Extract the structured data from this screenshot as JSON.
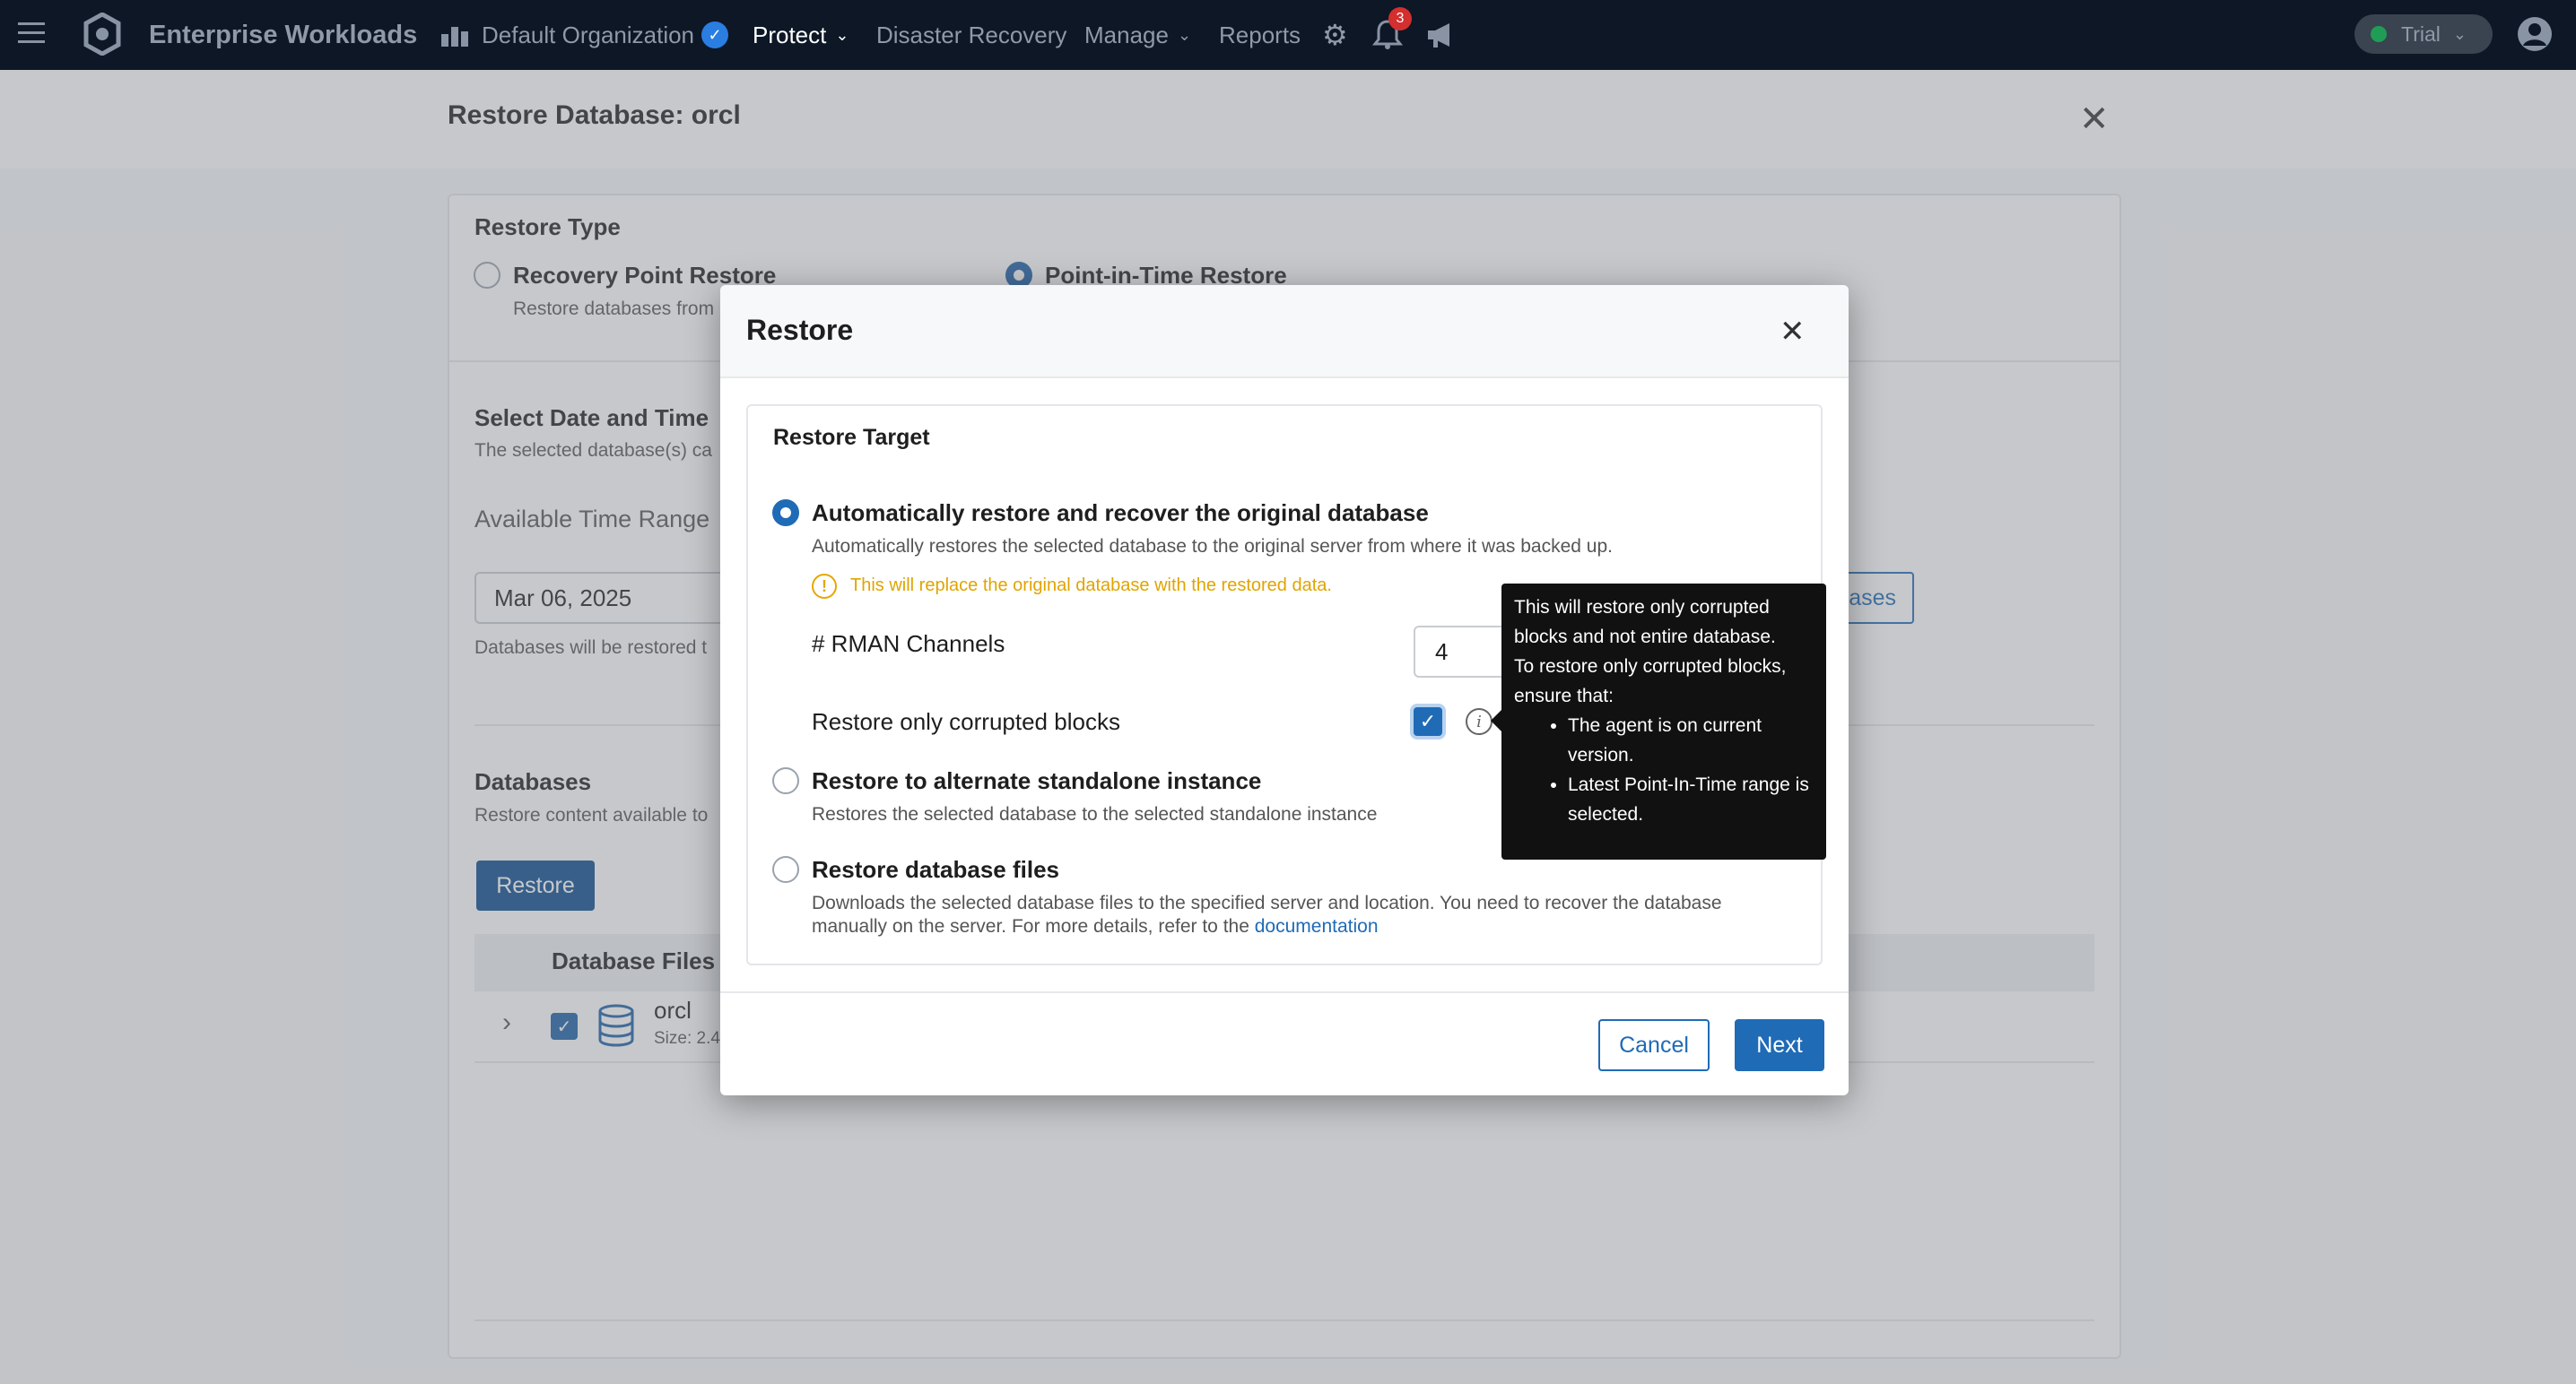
{
  "topnav": {
    "app_title": "Enterprise Workloads",
    "organization": "Default Organization",
    "items": [
      "Protect",
      "Disaster Recovery",
      "Manage",
      "Reports"
    ],
    "notification_count": "3",
    "trial_label": "Trial"
  },
  "page": {
    "title": "Restore Database: orcl",
    "restore_type_heading": "Restore Type",
    "option_recovery_point": "Recovery Point Restore",
    "option_recovery_point_desc": "Restore databases from",
    "option_pit": "Point-in-Time Restore",
    "select_date_heading": "Select Date and Time",
    "select_date_sub": "The selected database(s) ca",
    "available_time_range": "Available Time Range",
    "date_value": "Mar 06, 2025",
    "restored_note": "Databases will be restored t",
    "right_button_partial": "ases",
    "databases_heading": "Databases",
    "databases_sub": "Restore content available to",
    "restore_button": "Restore",
    "table_header": "Database Files",
    "row_name": "orcl",
    "row_size": "Size: 2.4"
  },
  "modal": {
    "title": "Restore",
    "section_title": "Restore Target",
    "option_auto_label": "Automatically restore and recover the original database",
    "option_auto_desc": "Automatically restores the selected database to the original server from where it was backed up.",
    "warning_text": "This will replace the original database with the restored data.",
    "rman_label": "# RMAN Channels",
    "rman_value": "4",
    "corrupted_label": "Restore only corrupted blocks",
    "corrupted_checked": true,
    "option_alt_label": "Restore to alternate standalone instance",
    "option_alt_desc": "Restores the selected database to the selected standalone instance",
    "option_files_label": "Restore database files",
    "option_files_desc_line1": "Downloads the selected database files to the specified server and location. You need to recover the database",
    "option_files_desc_line2": "manually on the server. For more details, refer to the",
    "option_files_link": "documentation",
    "cancel_label": "Cancel",
    "next_label": "Next"
  },
  "tooltip": {
    "lines": [
      "This will restore only corrupted",
      "blocks and not entire database.",
      "To restore only corrupted blocks,",
      "ensure that:"
    ],
    "bullets": [
      "The agent is on current version.",
      "Latest Point-In-Time range is selected."
    ]
  },
  "colors": {
    "nav_bg": "#0d1726",
    "accent": "#1f6bb6",
    "warning": "#e0a400",
    "tooltip_bg": "#111111"
  },
  "icons": [
    "hamburger-menu-icon",
    "app-logo-icon",
    "organization-icon",
    "verified-badge-icon",
    "settings-gear-icon",
    "notification-bell-icon",
    "announcement-megaphone-icon",
    "chevron-down-icon",
    "user-avatar-icon",
    "close-icon",
    "warning-icon",
    "info-icon",
    "checkmark-icon",
    "database-icon",
    "chevron-right-icon"
  ]
}
